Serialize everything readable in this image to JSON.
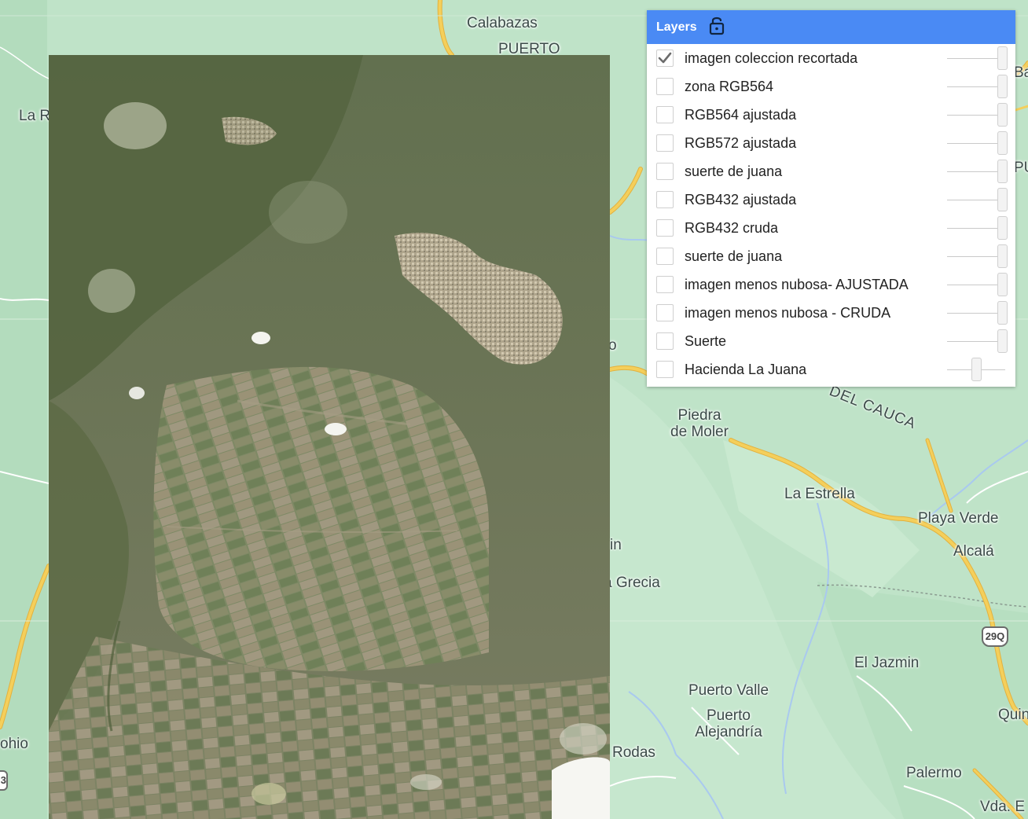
{
  "map": {
    "colors": {
      "land": "#bfe3c8",
      "land_dark": "#a8d8b2",
      "road_major": "#f4cf5b",
      "road_outline": "#e3b13e",
      "river": "#a9c9ef",
      "boundary": "#8a9a90",
      "imagery_base": "#6f7a5a"
    },
    "places": {
      "calabazas": "Calabazas",
      "puerto": "PUERTO",
      "la_r": "La R",
      "ba": "Ba",
      "pu": "PU",
      "piedra_de_moler_1": "Piedra",
      "piedra_de_moler_2": "de Moler",
      "del_cauca": "DEL CAUCA",
      "la_estrella": "La Estrella",
      "playa_verde": "Playa Verde",
      "alcala": "Alcalá",
      "in": "in",
      "grecia": "a Grecia",
      "o": "o",
      "el_jazmin": "El Jazmin",
      "puerto_valle": "Puerto Valle",
      "puerto_alejandria_1": "Puerto",
      "puerto_alejandria_2": "Alejandría",
      "quin": "Quin",
      "rodas": "Rodas",
      "palermo": "Palermo",
      "ohio": "ohio",
      "vda_e": "Vda. E"
    },
    "shields": {
      "route_29q": "29Q",
      "left_shield": "3"
    }
  },
  "layers_panel": {
    "title": "Layers",
    "lock_icon": "unlocked-padlock-icon",
    "layers": [
      {
        "label": "imagen coleccion recortada",
        "checked": true,
        "opacity": 1.0
      },
      {
        "label": "zona RGB564",
        "checked": false,
        "opacity": 1.0
      },
      {
        "label": "RGB564 ajustada",
        "checked": false,
        "opacity": 1.0
      },
      {
        "label": "RGB572 ajustada",
        "checked": false,
        "opacity": 1.0
      },
      {
        "label": "suerte de juana",
        "checked": false,
        "opacity": 1.0
      },
      {
        "label": "RGB432 ajustada",
        "checked": false,
        "opacity": 1.0
      },
      {
        "label": "RGB432 cruda",
        "checked": false,
        "opacity": 1.0
      },
      {
        "label": "suerte de juana",
        "checked": false,
        "opacity": 1.0
      },
      {
        "label": "imagen menos nubosa- AJUSTADA",
        "checked": false,
        "opacity": 1.0
      },
      {
        "label": "imagen menos nubosa - CRUDA",
        "checked": false,
        "opacity": 1.0
      },
      {
        "label": "Suerte",
        "checked": false,
        "opacity": 1.0
      },
      {
        "label": "Hacienda La Juana",
        "checked": false,
        "opacity": 0.5
      }
    ]
  }
}
